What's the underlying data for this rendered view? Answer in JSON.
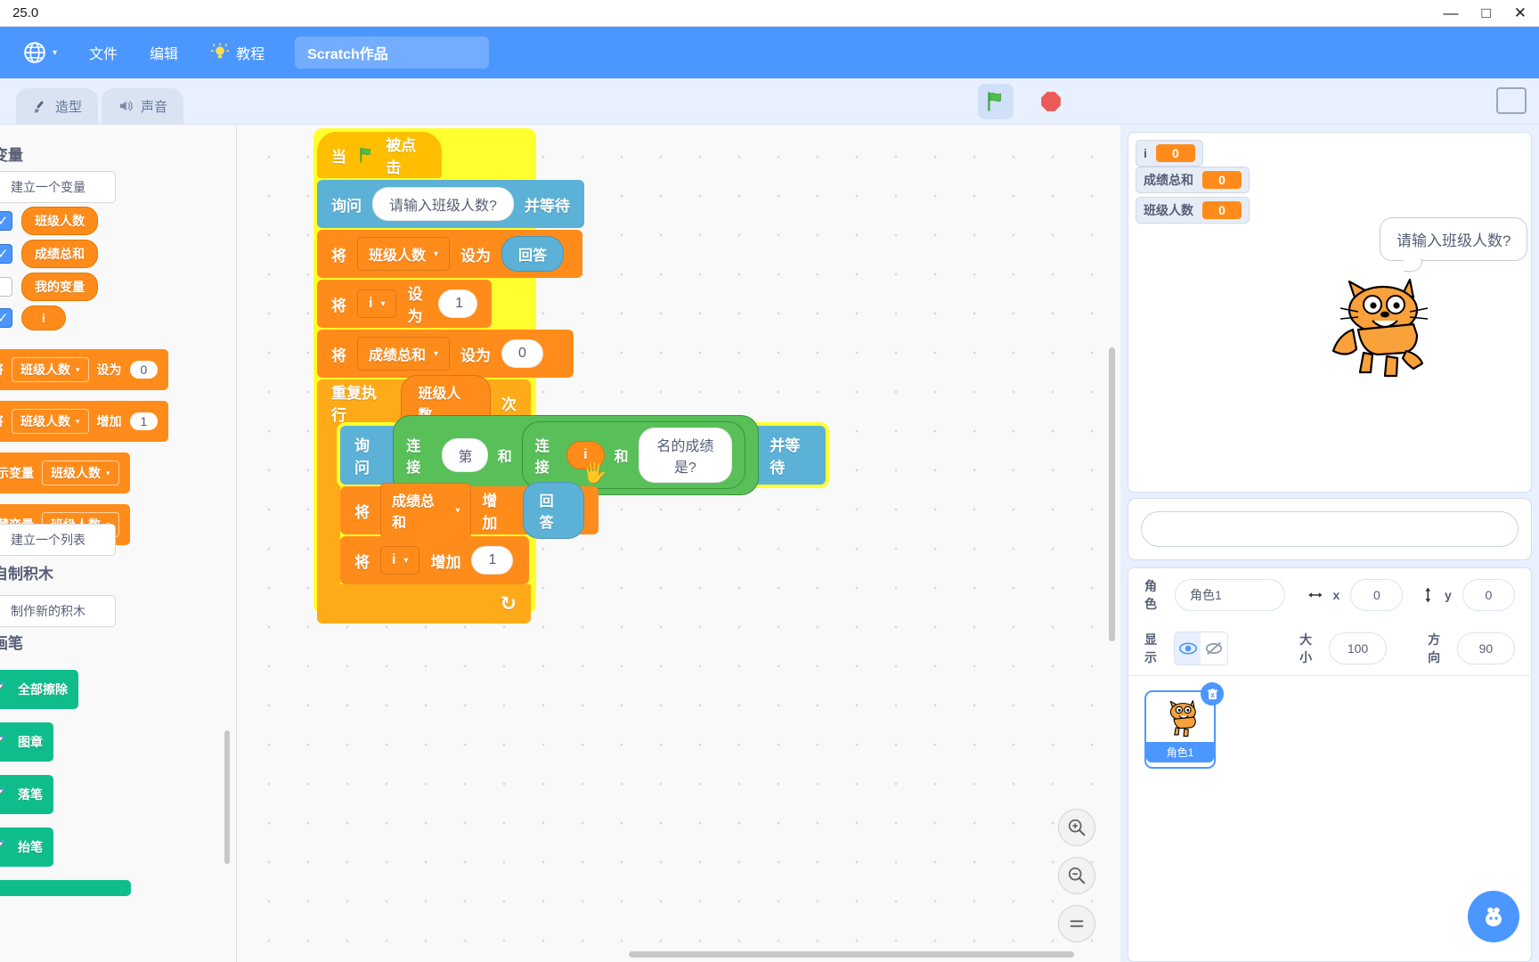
{
  "window": {
    "title": "25.0",
    "minimize": "—",
    "maximize": "□",
    "close": "✕"
  },
  "menubar": {
    "globe_icon": "globe-icon",
    "caret": "▾",
    "file": "文件",
    "edit": "编辑",
    "tutorial_icon": "lightbulb-icon",
    "tutorial": "教程",
    "project_name": "Scratch作品"
  },
  "tabs": [
    {
      "icon": "paintbrush-icon",
      "label": "造型"
    },
    {
      "icon": "speaker-icon",
      "label": "声音"
    }
  ],
  "controls": {
    "green_flag": "green-flag-icon",
    "stop": "stop-icon",
    "fullscreen": "fullscreen-icon"
  },
  "palette": {
    "variables_heading": "变量",
    "make_variable": "建立一个变量",
    "variables": [
      {
        "name": "班级人数",
        "checked": true
      },
      {
        "name": "成绩总和",
        "checked": true
      },
      {
        "name": "我的变量",
        "checked": false
      },
      {
        "name": "i",
        "checked": true
      }
    ],
    "blocks": [
      {
        "prefix": "将",
        "var": "班级人数",
        "mid": "设为",
        "value": "0"
      },
      {
        "prefix": "将",
        "var": "班级人数",
        "mid": "增加",
        "value": "1"
      },
      {
        "prefix": "显示变量",
        "var": "班级人数",
        "mid": "",
        "value": ""
      },
      {
        "prefix": "隐藏变量",
        "var": "班级人数",
        "mid": "",
        "value": ""
      }
    ],
    "make_list": "建立一个列表",
    "custom_heading": "自制积木",
    "make_block": "制作新的积木",
    "pen_heading": "画笔",
    "pen_blocks": [
      {
        "label": "全部擦除"
      },
      {
        "label": "图章"
      },
      {
        "label": "落笔"
      },
      {
        "label": "抬笔"
      }
    ],
    "dd_caret": "▾"
  },
  "script": {
    "hat": {
      "when": "当",
      "flag": "green-flag-icon",
      "clicked": "被点击"
    },
    "ask1": {
      "ask": "询问",
      "prompt": "请输入班级人数?",
      "wait": "并等待"
    },
    "set1": {
      "set": "将",
      "var": "班级人数",
      "to": "设为",
      "value": "回答"
    },
    "set2": {
      "set": "将",
      "var": "i",
      "to": "设为",
      "value": "1"
    },
    "set3": {
      "set": "将",
      "var": "成绩总和",
      "to": "设为",
      "value": "0"
    },
    "repeat": {
      "label": "重复执行",
      "count": "班级人数",
      "times": "次"
    },
    "ask2": {
      "ask": "询问",
      "join1": "连接",
      "arg1": "第",
      "and1": "和",
      "join2": "连接",
      "arg2": "i",
      "and2": "和",
      "arg3": "名的成绩是?",
      "wait": "并等待"
    },
    "change1": {
      "set": "将",
      "var": "成绩总和",
      "to": "增加",
      "value": "回答"
    },
    "change2": {
      "set": "将",
      "var": "i",
      "to": "增加",
      "value": "1"
    },
    "loop_arrow": "↻",
    "dd_caret": "▾"
  },
  "stage": {
    "monitors": [
      {
        "name": "i",
        "value": "0"
      },
      {
        "name": "成绩总和",
        "value": "0"
      },
      {
        "name": "班级人数",
        "value": "0"
      }
    ],
    "bubble_text": "请输入班级人数?",
    "sprite_icon": "scratch-cat-icon",
    "answer_placeholder": ""
  },
  "sprite_info": {
    "sprite_label": "角色",
    "sprite_name": "角色1",
    "x_icon": "horizontal-arrows-icon",
    "x_label": "x",
    "x_value": "0",
    "y_icon": "vertical-arrows-icon",
    "y_label": "y",
    "y_value": "0",
    "show_label": "显示",
    "show_icon": "eye-icon",
    "hide_icon": "eye-slash-icon",
    "size_label": "大小",
    "size_value": "100",
    "direction_label": "方向",
    "direction_value": "90",
    "card_name": "角色1",
    "delete_icon": "trash-icon",
    "add_sprite_icon": "add-sprite-icon"
  },
  "canvas_controls": {
    "zoom_in": "zoom-in-icon",
    "zoom_out": "zoom-out-icon",
    "zoom_reset": "zoom-reset-icon"
  }
}
